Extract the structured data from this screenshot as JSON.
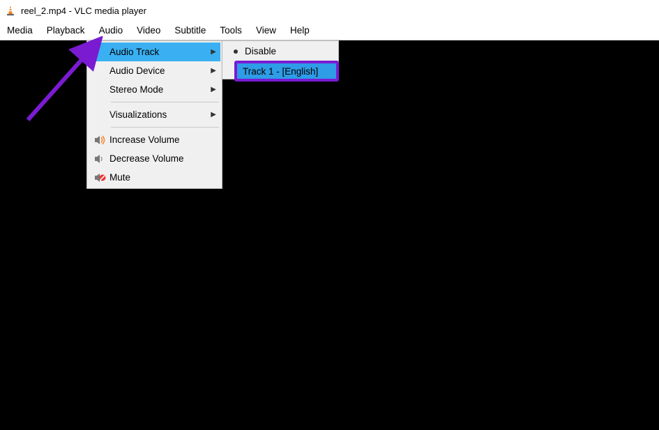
{
  "window": {
    "title": "reel_2.mp4 - VLC media player"
  },
  "menubar": {
    "items": [
      "Media",
      "Playback",
      "Audio",
      "Video",
      "Subtitle",
      "Tools",
      "View",
      "Help"
    ]
  },
  "audio_menu": {
    "audio_track": "Audio Track",
    "audio_device": "Audio Device",
    "stereo_mode": "Stereo Mode",
    "visualizations": "Visualizations",
    "increase_volume": "Increase Volume",
    "decrease_volume": "Decrease Volume",
    "mute": "Mute"
  },
  "audio_track_submenu": {
    "disable": "Disable",
    "track1": "Track 1 - [English]"
  }
}
